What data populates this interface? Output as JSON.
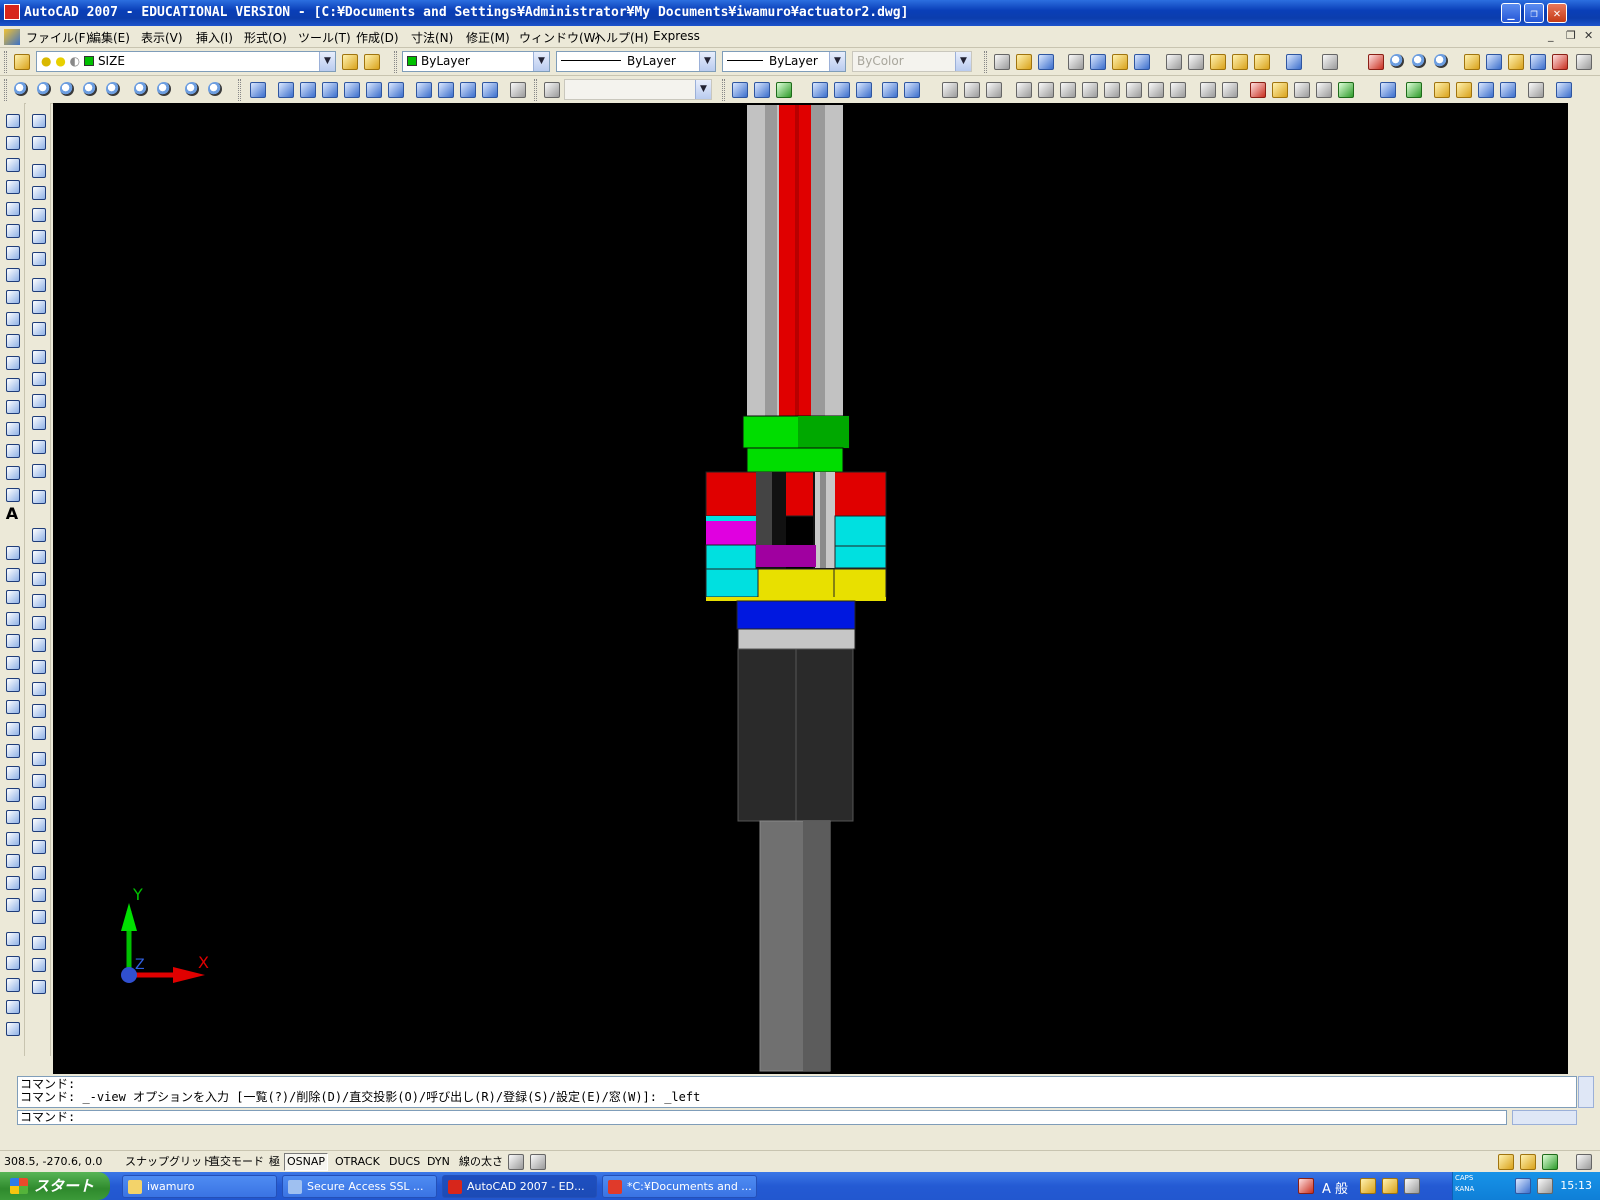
{
  "window": {
    "title": "AutoCAD 2007 - EDUCATIONAL VERSION - [C:¥Documents and Settings¥Administrator¥My Documents¥iwamuro¥actuator2.dwg]",
    "minimize": "_",
    "restore": "❐",
    "close": "✕"
  },
  "menu": {
    "items": [
      "ファイル(F)",
      "編集(E)",
      "表示(V)",
      "挿入(I)",
      "形式(O)",
      "ツール(T)",
      "作成(D)",
      "寸法(N)",
      "修正(M)",
      "ウィンドウ(W)",
      "ヘルプ(H)",
      "Express"
    ],
    "doc_minimize": "_",
    "doc_restore": "❐",
    "doc_close": "✕"
  },
  "layers": {
    "current_layer": "SIZE",
    "color": "ByLayer",
    "linetype": "ByLayer",
    "lineweight": "ByLayer",
    "plotstyle": "ByColor"
  },
  "command": {
    "history_1": "コマンド:",
    "history_2": "コマンド: _-view オプションを入力 [一覧(?)/削除(D)/直交投影(O)/呼び出し(R)/登録(S)/設定(E)/窓(W)]: _left",
    "prompt": "コマンド:"
  },
  "ucs": {
    "x_label": "X",
    "y_label": "Y",
    "z_label": "Z"
  },
  "status": {
    "coords": "308.5, -270.6, 0.0",
    "toggles": [
      {
        "label": "スナップ",
        "on": false
      },
      {
        "label": "グリッド",
        "on": false
      },
      {
        "label": "直交モード",
        "on": false
      },
      {
        "label": "極",
        "on": false
      },
      {
        "label": "OSNAP",
        "on": true
      },
      {
        "label": "OTRACK",
        "on": false
      },
      {
        "label": "DUCS",
        "on": false
      },
      {
        "label": "DYN",
        "on": false
      },
      {
        "label": "線の太さ",
        "on": false
      }
    ]
  },
  "taskbar": {
    "start": "スタート",
    "tasks": [
      "iwamuro",
      "Secure Access SSL ...",
      "AutoCAD 2007 - ED...",
      "*C:¥Documents and ..."
    ],
    "ime": "A 般",
    "caps": "CAPS",
    "kana": "KANA",
    "clock": "15:13"
  },
  "colors": {
    "rod_red": "#e00000",
    "tube_grey": "#bdbdbd",
    "green": "#00d800",
    "cyan": "#00e0e0",
    "magenta": "#e000e0",
    "purple": "#a000a0",
    "yellow": "#e8e000",
    "blue": "#0018e0",
    "dark": "#2b2b2b"
  }
}
